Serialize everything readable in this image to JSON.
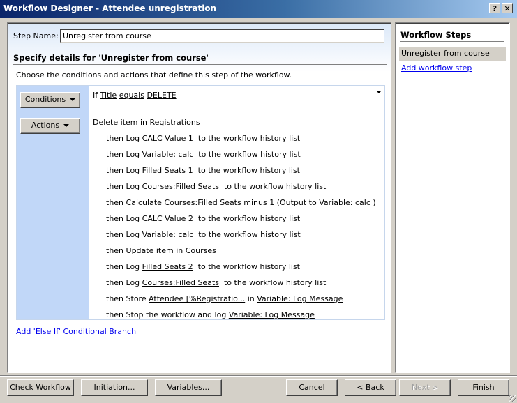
{
  "window": {
    "title": "Workflow Designer - Attendee unregistration",
    "help_label": "?",
    "close_label": "✕"
  },
  "step": {
    "label": "Step Name:",
    "value": "Unregister from course"
  },
  "details": {
    "title": "Specify details for 'Unregister from course'",
    "description": "Choose the conditions and actions that define this step of the workflow."
  },
  "rule": {
    "conditions_button": "Conditions",
    "actions_button": "Actions",
    "condition": {
      "prefix": "If",
      "field": "Title",
      "operator": "equals",
      "value": "DELETE"
    },
    "actions": [
      {
        "indent": false,
        "parts": [
          {
            "t": "Delete item in "
          },
          {
            "t": "Registrations",
            "link": true
          }
        ]
      },
      {
        "indent": true,
        "parts": [
          {
            "t": "then Log "
          },
          {
            "t": "CALC Value 1 ",
            "link": true
          },
          {
            "t": " to the workflow history list"
          }
        ]
      },
      {
        "indent": true,
        "parts": [
          {
            "t": "then Log "
          },
          {
            "t": "Variable: calc",
            "link": true
          },
          {
            "t": "  to the workflow history list"
          }
        ]
      },
      {
        "indent": true,
        "parts": [
          {
            "t": "then Log "
          },
          {
            "t": "Filled Seats 1",
            "link": true
          },
          {
            "t": "  to the workflow history list"
          }
        ]
      },
      {
        "indent": true,
        "parts": [
          {
            "t": "then Log "
          },
          {
            "t": "Courses:Filled Seats",
            "link": true
          },
          {
            "t": "  to the workflow history list"
          }
        ]
      },
      {
        "indent": true,
        "parts": [
          {
            "t": "then Calculate "
          },
          {
            "t": "Courses:Filled Seats",
            "link": true
          },
          {
            "t": " "
          },
          {
            "t": "minus",
            "link": true
          },
          {
            "t": " "
          },
          {
            "t": "1",
            "link": true
          },
          {
            "t": " (Output to "
          },
          {
            "t": "Variable: calc",
            "link": true
          },
          {
            "t": " )"
          }
        ]
      },
      {
        "indent": true,
        "parts": [
          {
            "t": "then Log "
          },
          {
            "t": "CALC Value 2",
            "link": true
          },
          {
            "t": "  to the workflow history list"
          }
        ]
      },
      {
        "indent": true,
        "parts": [
          {
            "t": "then Log "
          },
          {
            "t": "Variable: calc",
            "link": true
          },
          {
            "t": "  to the workflow history list"
          }
        ]
      },
      {
        "indent": true,
        "parts": [
          {
            "t": "then Update item in "
          },
          {
            "t": "Courses",
            "link": true
          }
        ]
      },
      {
        "indent": true,
        "parts": [
          {
            "t": "then Log "
          },
          {
            "t": "Filled Seats 2",
            "link": true
          },
          {
            "t": "  to the workflow history list"
          }
        ]
      },
      {
        "indent": true,
        "parts": [
          {
            "t": "then Log "
          },
          {
            "t": "Courses:Filled Seats",
            "link": true
          },
          {
            "t": "  to the workflow history list"
          }
        ]
      },
      {
        "indent": true,
        "parts": [
          {
            "t": "then Store "
          },
          {
            "t": "Attendee [%Registratio...",
            "link": true
          },
          {
            "t": " in "
          },
          {
            "t": "Variable: Log Message",
            "link": true
          }
        ]
      },
      {
        "indent": true,
        "parts": [
          {
            "t": "then Stop the workflow and log "
          },
          {
            "t": "Variable: Log Message",
            "link": true
          }
        ]
      }
    ],
    "else_if_link": "Add 'Else If' Conditional Branch"
  },
  "workflow_steps": {
    "title": "Workflow Steps",
    "items": [
      "Unregister from course"
    ],
    "add_link": "Add workflow step"
  },
  "footer": {
    "check_workflow": "Check Workflow",
    "initiation": "Initiation...",
    "variables": "Variables...",
    "cancel": "Cancel",
    "back": "< Back",
    "next": "Next >",
    "finish": "Finish"
  },
  "colors": {
    "link": "#0000ee",
    "rule_sidebar": "#c1d7f8",
    "title_bar": "#0a246a"
  }
}
